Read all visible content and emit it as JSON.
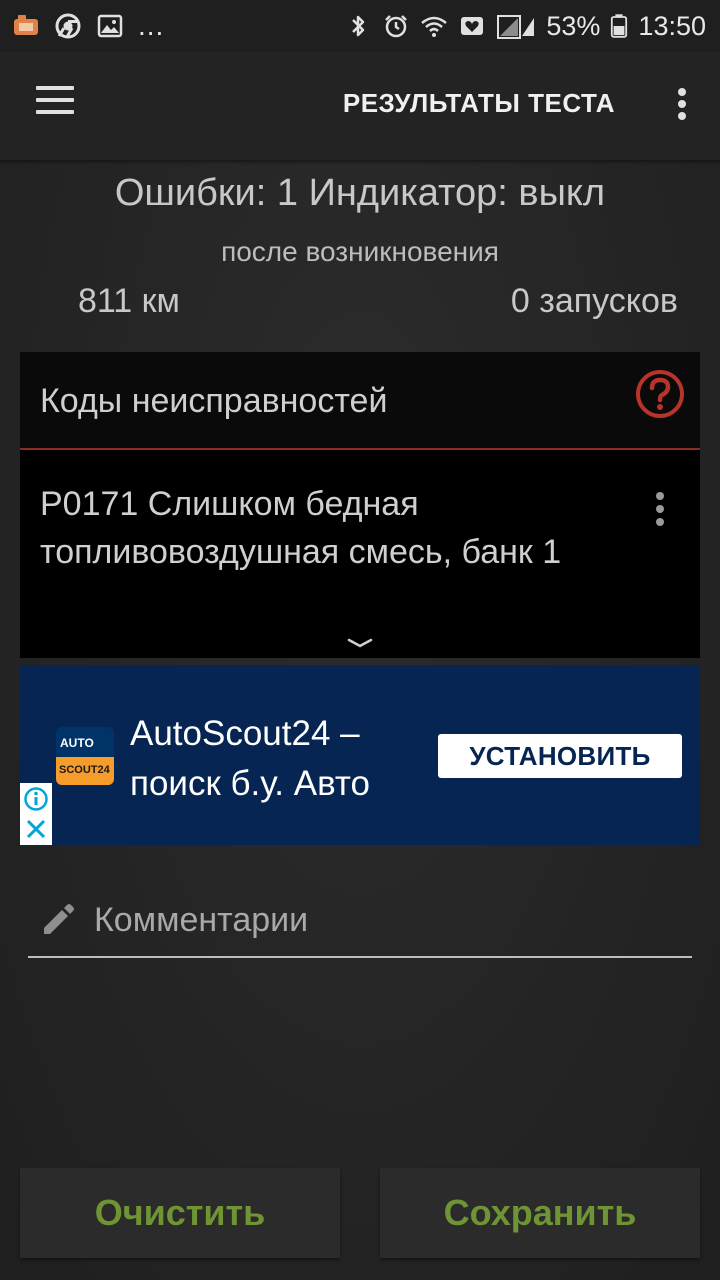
{
  "status_bar": {
    "overflow_indicator": "...",
    "battery_percent": "53%",
    "time": "13:50",
    "icons_left": [
      "app-notification-icon",
      "chrome-icon",
      "gallery-icon"
    ],
    "icons_right": [
      "bluetooth-icon",
      "alarm-icon",
      "wifi-icon",
      "heart-icon",
      "signal-icon",
      "battery-icon"
    ]
  },
  "app_bar": {
    "title": "РЕЗУЛЬТАТЫ ТЕСТА",
    "menu_icon": "hamburger-menu-icon",
    "overflow_icon": "more-vert-icon"
  },
  "summary": {
    "errors_indicator": "Ошибки: 1 Индикатор: выкл",
    "since_label": "после возникновения",
    "distance": "811 км",
    "starts": "0 запусков"
  },
  "dtc_card": {
    "title": "Коды неисправностей",
    "help_icon": "help-circle-icon",
    "code_text": "P0171 Слишком бедная топливовоздушная смесь, банк 1",
    "accent_color": "#8e2a22"
  },
  "ad": {
    "logo_top": "AUTO",
    "logo_bottom": "SCOUT24",
    "title": "AutoScout24 – поиск б.у. Авто",
    "install_button": "УСТАНОВИТЬ",
    "background_color": "#062552"
  },
  "comment": {
    "placeholder": "Комментарии",
    "value": ""
  },
  "buttons": {
    "clear_label": "Очистить",
    "save_label": "Сохранить",
    "label_color": "#6f9433"
  }
}
